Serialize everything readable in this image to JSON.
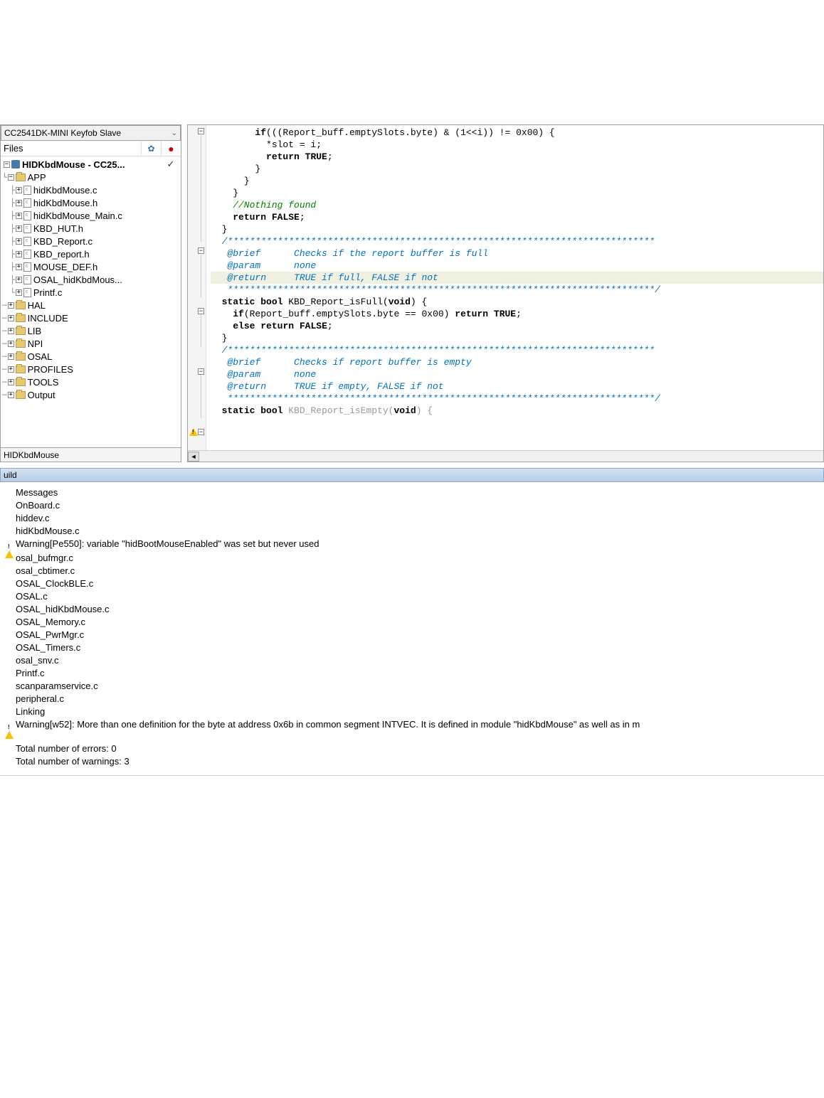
{
  "config_dropdown": "CC2541DK-MINI Keyfob Slave",
  "files_header": "Files",
  "project_name": "HIDKbdMouse - CC25...",
  "tree": {
    "app": "APP",
    "files_app": [
      "hidKbdMouse.c",
      "hidKbdMouse.h",
      "hidKbdMouse_Main.c",
      "KBD_HUT.h",
      "KBD_Report.c",
      "KBD_report.h",
      "MOUSE_DEF.h",
      "OSAL_hidKbdMous...",
      "Printf.c"
    ],
    "folders": [
      "HAL",
      "INCLUDE",
      "LIB",
      "NPI",
      "OSAL",
      "PROFILES",
      "TOOLS",
      "Output"
    ]
  },
  "bottom_tab": "HIDKbdMouse",
  "code_lines": [
    {
      "t": "        if(((Report_buff.emptySlots.byte) & (1<<i)) != 0x00) {",
      "cls": ""
    },
    {
      "t": "          *slot = i;",
      "cls": ""
    },
    {
      "t": "          return TRUE;",
      "cls": "kw-return"
    },
    {
      "t": "        }",
      "cls": ""
    },
    {
      "t": "      }",
      "cls": ""
    },
    {
      "t": "    }",
      "cls": ""
    },
    {
      "t": "    //Nothing found",
      "cls": "cmg"
    },
    {
      "t": "    return FALSE;",
      "cls": "kw-return"
    },
    {
      "t": "  }",
      "cls": ""
    },
    {
      "t": "",
      "cls": ""
    },
    {
      "t": "  /*****************************************************************************",
      "cls": "cm"
    },
    {
      "t": "   @brief      Checks if the report buffer is full",
      "cls": "cm"
    },
    {
      "t": "   @param      none",
      "cls": "cm"
    },
    {
      "t": "   @return     TRUE if full, FALSE if not",
      "cls": "cm hl"
    },
    {
      "t": "   *****************************************************************************/",
      "cls": "cm"
    },
    {
      "t": "  static bool KBD_Report_isFull(void) {",
      "cls": "kw-static"
    },
    {
      "t": "    if(Report_buff.emptySlots.byte == 0x00) return TRUE;",
      "cls": "kw-if"
    },
    {
      "t": "    else return FALSE;",
      "cls": "kw-else"
    },
    {
      "t": "  }",
      "cls": ""
    },
    {
      "t": "",
      "cls": ""
    },
    {
      "t": "  /*****************************************************************************",
      "cls": "cm"
    },
    {
      "t": "   @brief      Checks if report buffer is empty",
      "cls": "cm"
    },
    {
      "t": "   @param      none",
      "cls": "cm"
    },
    {
      "t": "   @return     TRUE if empty, FALSE if not",
      "cls": "cm"
    },
    {
      "t": "   *****************************************************************************/",
      "cls": "cm"
    },
    {
      "t": "  static bool KBD_Report_isEmpty(void) {",
      "cls": "kw-static dim"
    }
  ],
  "build": {
    "title": "uild",
    "header": "Messages",
    "rows": [
      {
        "icon": "",
        "t": "OnBoard.c"
      },
      {
        "icon": "",
        "t": "hiddev.c"
      },
      {
        "icon": "",
        "t": "hidKbdMouse.c"
      },
      {
        "icon": "warn",
        "t": "Warning[Pe550]: variable \"hidBootMouseEnabled\" was set but never used"
      },
      {
        "icon": "",
        "t": "osal_bufmgr.c"
      },
      {
        "icon": "",
        "t": "osal_cbtimer.c"
      },
      {
        "icon": "",
        "t": "OSAL_ClockBLE.c"
      },
      {
        "icon": "",
        "t": "OSAL.c"
      },
      {
        "icon": "",
        "t": "OSAL_hidKbdMouse.c"
      },
      {
        "icon": "",
        "t": "OSAL_Memory.c"
      },
      {
        "icon": "",
        "t": "OSAL_PwrMgr.c"
      },
      {
        "icon": "",
        "t": "OSAL_Timers.c"
      },
      {
        "icon": "",
        "t": "osal_snv.c"
      },
      {
        "icon": "",
        "t": "Printf.c"
      },
      {
        "icon": "",
        "t": "scanparamservice.c"
      },
      {
        "icon": "",
        "t": "peripheral.c"
      },
      {
        "icon": "",
        "t": "Linking"
      },
      {
        "icon": "warn",
        "t": "Warning[w52]: More than one definition for the byte at address 0x6b in common segment INTVEC. It is defined in module \"hidKbdMouse\" as well as in m"
      }
    ],
    "summary_errors": "Total number of errors: 0",
    "summary_warnings": "Total number of warnings: 3"
  }
}
